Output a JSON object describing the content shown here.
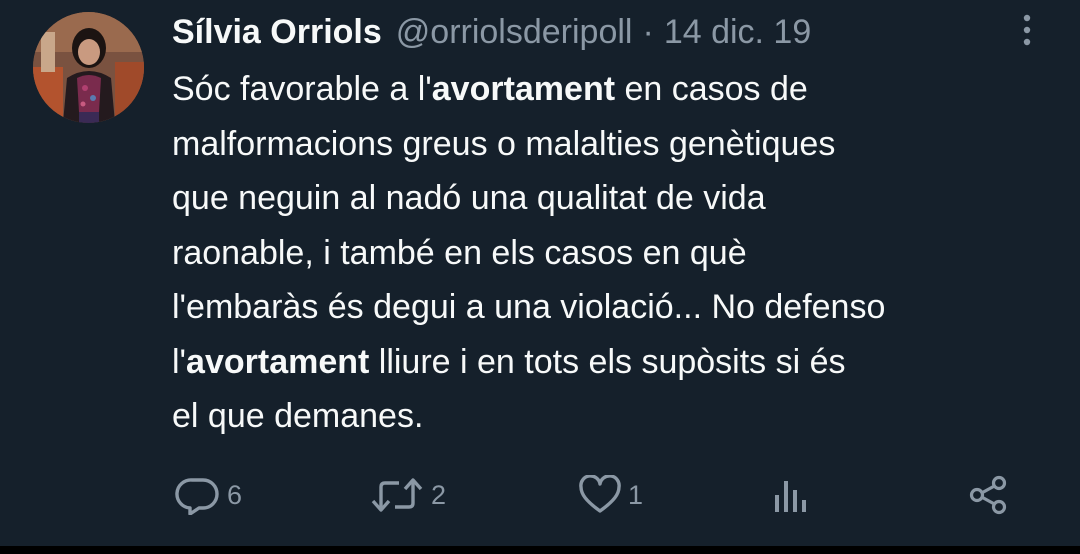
{
  "tweet": {
    "author": {
      "display_name": "Sílvia Orriols",
      "handle": "@orriolsderipoll",
      "separator": "·",
      "date": "14 dic. 19"
    },
    "lines": [
      {
        "pre": "Sóc favorable a l'",
        "bold": "avortament",
        "post": " en casos de"
      },
      {
        "pre": "malformacions greus o malalties genètiques",
        "bold": "",
        "post": ""
      },
      {
        "pre": "que neguin al nadó una qualitat de vida",
        "bold": "",
        "post": ""
      },
      {
        "pre": "raonable,  i també en els casos en què",
        "bold": "",
        "post": ""
      },
      {
        "pre": "l'embaràs és degui a una violació... No defenso",
        "bold": "",
        "post": ""
      },
      {
        "pre": "l'",
        "bold": "avortament",
        "post": " lliure i en tots els supòsits si és"
      },
      {
        "pre": "el que demanes.",
        "bold": "",
        "post": ""
      }
    ],
    "actions": {
      "reply_count": "6",
      "retweet_count": "2",
      "like_count": "1"
    }
  },
  "colors": {
    "background": "#15202b",
    "text": "#f7f9f9",
    "secondary": "#8b98a5"
  },
  "icons": [
    "more-vertical-icon",
    "reply-icon",
    "retweet-icon",
    "like-icon",
    "views-icon",
    "share-icon"
  ]
}
